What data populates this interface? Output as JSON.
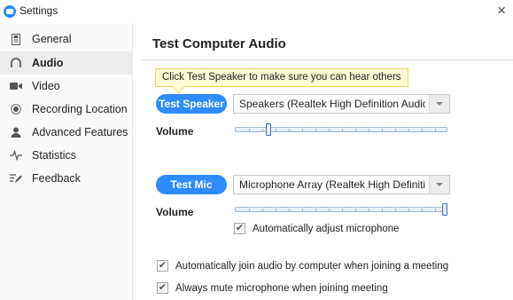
{
  "window": {
    "title": "Settings",
    "close_glyph": "×"
  },
  "sidebar": {
    "items": [
      {
        "label": "General",
        "icon": "general-icon",
        "active": false
      },
      {
        "label": "Audio",
        "icon": "headphones-icon",
        "active": true
      },
      {
        "label": "Video",
        "icon": "video-camera-icon",
        "active": false
      },
      {
        "label": "Recording Location",
        "icon": "record-icon",
        "active": false
      },
      {
        "label": "Advanced Features",
        "icon": "user-icon",
        "active": false
      },
      {
        "label": "Statistics",
        "icon": "pulse-icon",
        "active": false
      },
      {
        "label": "Feedback",
        "icon": "feedback-icon",
        "active": false
      }
    ]
  },
  "main": {
    "title": "Test Computer Audio",
    "tooltip": "Click Test Speaker to make sure you can hear others",
    "speaker": {
      "button_label": "Test Speaker",
      "device": "Speakers (Realtek High Definition Audio(SST))",
      "volume_label": "Volume",
      "volume_fraction": 0.16
    },
    "mic": {
      "button_label": "Test Mic",
      "device": "Microphone Array (Realtek High Definition Audio(SST))",
      "volume_label": "Volume",
      "volume_fraction": 1.0,
      "auto_adjust": {
        "label": "Automatically adjust microphone",
        "checked": true
      }
    },
    "options": [
      {
        "label": "Automatically join audio by computer when joining a meeting",
        "checked": true
      },
      {
        "label": "Always mute microphone when joining meeting",
        "checked": true
      }
    ]
  },
  "colors": {
    "accent": "#2d8cff",
    "tooltip_bg": "#fdfbd6",
    "slider_border": "#3b6fc4"
  }
}
